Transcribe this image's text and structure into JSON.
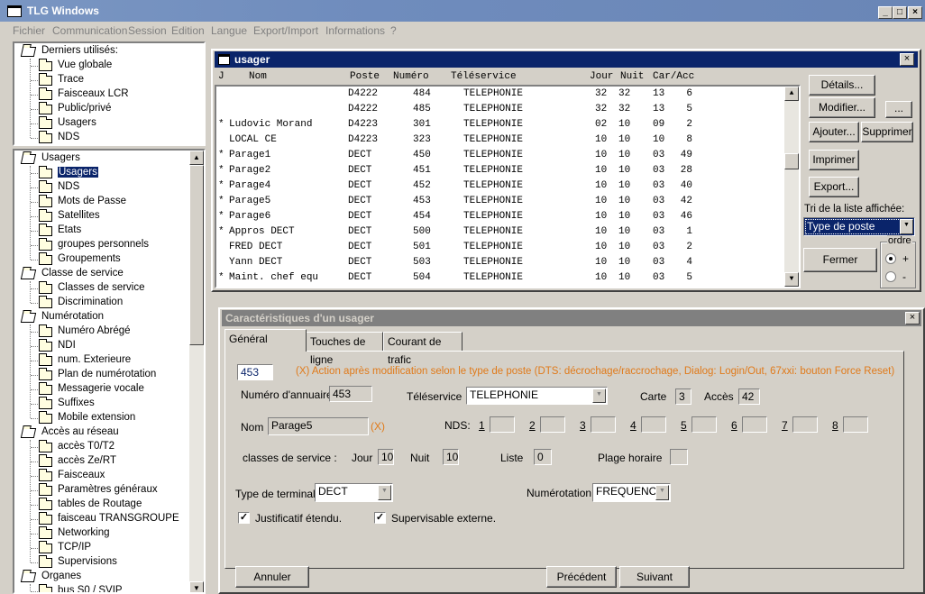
{
  "app": {
    "title": "TLG Windows"
  },
  "menu": [
    "Fichier",
    "Communication",
    "Session",
    "Edition",
    "Langue",
    "Export/Import",
    "Informations",
    "?"
  ],
  "recent": {
    "header": "Derniers utilisés:",
    "items": [
      "Vue globale",
      "Trace",
      "Faisceaux LCR",
      "Public/privé",
      "Usagers",
      "NDS"
    ]
  },
  "tree": [
    {
      "label": "Usagers",
      "level": 0
    },
    {
      "label": "Usagers",
      "level": 1,
      "selected": true
    },
    {
      "label": "NDS",
      "level": 1
    },
    {
      "label": "Mots de Passe",
      "level": 1
    },
    {
      "label": "Satellites",
      "level": 1
    },
    {
      "label": "Etats",
      "level": 1
    },
    {
      "label": "groupes personnels",
      "level": 1
    },
    {
      "label": "Groupements",
      "level": 1
    },
    {
      "label": "Classe de service",
      "level": 0
    },
    {
      "label": "Classes de service",
      "level": 1
    },
    {
      "label": "Discrimination",
      "level": 1
    },
    {
      "label": "Numérotation",
      "level": 0
    },
    {
      "label": "Numéro Abrégé",
      "level": 1
    },
    {
      "label": "NDI",
      "level": 1
    },
    {
      "label": "num. Exterieure",
      "level": 1
    },
    {
      "label": "Plan de numérotation",
      "level": 1
    },
    {
      "label": "Messagerie vocale",
      "level": 1
    },
    {
      "label": "Suffixes",
      "level": 1
    },
    {
      "label": "Mobile extension",
      "level": 1
    },
    {
      "label": "Accès au réseau",
      "level": 0
    },
    {
      "label": "accès T0/T2",
      "level": 1
    },
    {
      "label": "accès Ze/RT",
      "level": 1
    },
    {
      "label": "Faisceaux",
      "level": 1
    },
    {
      "label": "Paramètres généraux",
      "level": 1
    },
    {
      "label": "tables de Routage",
      "level": 1
    },
    {
      "label": "faisceau TRANSGROUPE",
      "level": 1
    },
    {
      "label": "Networking",
      "level": 1
    },
    {
      "label": "TCP/IP",
      "level": 1
    },
    {
      "label": "Supervisions",
      "level": 1
    },
    {
      "label": "Organes",
      "level": 0
    },
    {
      "label": "bus S0 / SVIP",
      "level": 1
    }
  ],
  "usager": {
    "title": "usager",
    "columns": [
      "J",
      "Nom",
      "Poste",
      "Numéro",
      "Téléservice",
      "Jour",
      "Nuit",
      "Car/Acc"
    ],
    "rows": [
      {
        "j": "",
        "nom": "",
        "poste": "D4222",
        "numero": "484",
        "teleservice": "TELEPHONIE",
        "jour": "32",
        "nuit": "32",
        "car": "13",
        "acc": "6"
      },
      {
        "j": "",
        "nom": "",
        "poste": "D4222",
        "numero": "485",
        "teleservice": "TELEPHONIE",
        "jour": "32",
        "nuit": "32",
        "car": "13",
        "acc": "5"
      },
      {
        "j": "*",
        "nom": "Ludovic Morand",
        "poste": "D4223",
        "numero": "301",
        "teleservice": "TELEPHONIE",
        "jour": "02",
        "nuit": "10",
        "car": "09",
        "acc": "2"
      },
      {
        "j": "",
        "nom": "LOCAL CE",
        "poste": "D4223",
        "numero": "323",
        "teleservice": "TELEPHONIE",
        "jour": "10",
        "nuit": "10",
        "car": "10",
        "acc": "8"
      },
      {
        "j": "*",
        "nom": "Parage1",
        "poste": "DECT",
        "numero": "450",
        "teleservice": "TELEPHONIE",
        "jour": "10",
        "nuit": "10",
        "car": "03",
        "acc": "49"
      },
      {
        "j": "*",
        "nom": "Parage2",
        "poste": "DECT",
        "numero": "451",
        "teleservice": "TELEPHONIE",
        "jour": "10",
        "nuit": "10",
        "car": "03",
        "acc": "28"
      },
      {
        "j": "*",
        "nom": "Parage4",
        "poste": "DECT",
        "numero": "452",
        "teleservice": "TELEPHONIE",
        "jour": "10",
        "nuit": "10",
        "car": "03",
        "acc": "40"
      },
      {
        "j": "*",
        "nom": "Parage5",
        "poste": "DECT",
        "numero": "453",
        "teleservice": "TELEPHONIE",
        "jour": "10",
        "nuit": "10",
        "car": "03",
        "acc": "42"
      },
      {
        "j": "*",
        "nom": "Parage6",
        "poste": "DECT",
        "numero": "454",
        "teleservice": "TELEPHONIE",
        "jour": "10",
        "nuit": "10",
        "car": "03",
        "acc": "46"
      },
      {
        "j": "*",
        "nom": "Appros DECT",
        "poste": "DECT",
        "numero": "500",
        "teleservice": "TELEPHONIE",
        "jour": "10",
        "nuit": "10",
        "car": "03",
        "acc": "1"
      },
      {
        "j": "",
        "nom": "FRED DECT",
        "poste": "DECT",
        "numero": "501",
        "teleservice": "TELEPHONIE",
        "jour": "10",
        "nuit": "10",
        "car": "03",
        "acc": "2"
      },
      {
        "j": "",
        "nom": "Yann DECT",
        "poste": "DECT",
        "numero": "503",
        "teleservice": "TELEPHONIE",
        "jour": "10",
        "nuit": "10",
        "car": "03",
        "acc": "4"
      },
      {
        "j": "*",
        "nom": "Maint. chef equ",
        "poste": "DECT",
        "numero": "504",
        "teleservice": "TELEPHONIE",
        "jour": "10",
        "nuit": "10",
        "car": "03",
        "acc": "5"
      }
    ],
    "buttons": {
      "details": "Détails...",
      "modifier": "Modifier...",
      "more": "...",
      "ajouter": "Ajouter...",
      "supprimer": "Supprimer",
      "imprimer": "Imprimer",
      "export": "Export...",
      "fermer": "Fermer"
    },
    "sort_label": "Tri de la liste affichée:",
    "sort_value": "Type de poste",
    "order_label": "ordre",
    "order_plus": "+",
    "order_minus": "-"
  },
  "carac": {
    "title": "Caractéristiques d'un usager",
    "tabs": [
      "Général",
      "Touches de ligne",
      "Courant de trafic"
    ],
    "number_value": "453",
    "note": "(X) Action après modification selon le type de poste (DTS: décrochage/raccrochage, Dialog: Login/Out, 67xxi: bouton Force Reset)",
    "annuaire_label": "Numéro d'annuaire",
    "annuaire_value": "453",
    "teleservice_label": "Téléservice",
    "teleservice_value": "TELEPHONIE",
    "carte_label": "Carte",
    "carte_value": "3",
    "acces_label": "Accès",
    "acces_value": "42",
    "nom_label": "Nom",
    "nom_value": "Parage5",
    "nom_x": "(X)",
    "nds_label": "NDS:",
    "nds_slots": [
      "1",
      "2",
      "3",
      "4",
      "5",
      "6",
      "7",
      "8"
    ],
    "classes_label": "classes de service :",
    "jour_label": "Jour",
    "jour_value": "10",
    "nuit_label": "Nuit",
    "nuit_value": "10",
    "liste_label": "Liste",
    "liste_value": "0",
    "plage_label": "Plage horaire",
    "plage_value": "",
    "terminal_label": "Type de terminal",
    "terminal_value": "DECT",
    "numerotation_label": "Numérotation",
    "numerotation_value": "FREQUENCE",
    "justif_label": "Justificatif étendu.",
    "superv_label": "Supervisable externe.",
    "buttons": {
      "annuler": "Annuler",
      "precedent": "Précédent",
      "suivant": "Suivant"
    }
  },
  "colors": {
    "title_active": "#0a246a",
    "title_inactive": "#808080",
    "note": "#e07a1a",
    "face": "#d4d0c8"
  }
}
